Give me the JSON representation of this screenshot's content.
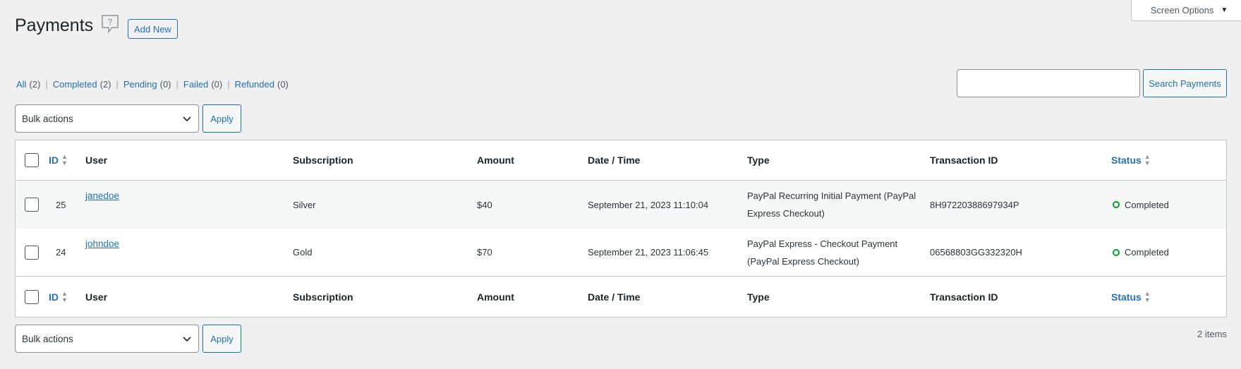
{
  "header": {
    "title": "Payments",
    "add_new_label": "Add New",
    "screen_options_label": "Screen Options"
  },
  "filters": [
    {
      "label": "All",
      "count": "(2)"
    },
    {
      "label": "Completed",
      "count": "(2)"
    },
    {
      "label": "Pending",
      "count": "(0)"
    },
    {
      "label": "Failed",
      "count": "(0)"
    },
    {
      "label": "Refunded",
      "count": "(0)"
    }
  ],
  "search": {
    "value": "",
    "button_label": "Search Payments"
  },
  "bulk_top": {
    "selected": "Bulk actions",
    "apply_label": "Apply"
  },
  "bulk_bottom": {
    "selected": "Bulk actions",
    "apply_label": "Apply"
  },
  "columns": {
    "id": "ID",
    "user": "User",
    "subscription": "Subscription",
    "amount": "Amount",
    "datetime": "Date / Time",
    "type": "Type",
    "transaction_id": "Transaction ID",
    "status": "Status"
  },
  "rows": [
    {
      "id": "25",
      "user": "janedoe",
      "subscription": "Silver",
      "amount": "$40",
      "datetime": "September 21, 2023 11:10:04",
      "type_line1": "PayPal Recurring Initial Payment (PayPal",
      "type_line2": "Express Checkout)",
      "transaction_id": "8H97220388697934P",
      "status": "Completed"
    },
    {
      "id": "24",
      "user": "johndoe",
      "subscription": "Gold",
      "amount": "$70",
      "datetime": "September 21, 2023 11:06:45",
      "type_line1": "PayPal Express - Checkout Payment",
      "type_line2": "(PayPal Express Checkout)",
      "transaction_id": "06568803GG332320H",
      "status": "Completed"
    }
  ],
  "items_count": "2 items",
  "colors": {
    "accent": "#2271b1",
    "status_completed": "#00a32a",
    "background": "#f0f0f1"
  }
}
